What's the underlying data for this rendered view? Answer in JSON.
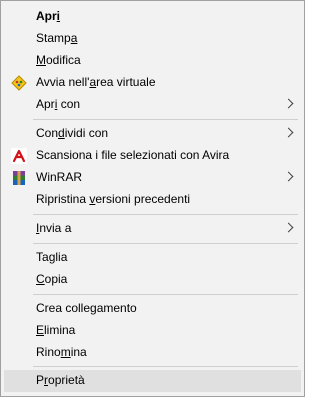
{
  "menu": {
    "items": [
      {
        "id": "apri",
        "pre": "Apr",
        "u": "i",
        "post": "",
        "bold": true
      },
      {
        "id": "stampa",
        "pre": "Stamp",
        "u": "a",
        "post": ""
      },
      {
        "id": "modifica",
        "pre": "",
        "u": "M",
        "post": "odifica"
      },
      {
        "id": "avvia",
        "pre": "Avvia nell'",
        "u": "a",
        "post": "rea virtuale"
      },
      {
        "id": "apri-con",
        "pre": "Apr",
        "u": "i",
        "post": " con"
      },
      {
        "id": "condividi",
        "pre": "Con",
        "u": "d",
        "post": "ividi con"
      },
      {
        "id": "avira",
        "text": "Scansiona i file selezionati con Avira"
      },
      {
        "id": "winrar",
        "text": "WinRAR"
      },
      {
        "id": "ripristina",
        "pre": "Ripristina ",
        "u": "v",
        "post": "ersioni precedenti"
      },
      {
        "id": "invia",
        "pre": "",
        "u": "I",
        "post": "nvia a"
      },
      {
        "id": "taglia",
        "pre": "Ta",
        "u": "g",
        "post": "lia"
      },
      {
        "id": "copia",
        "pre": "",
        "u": "C",
        "post": "opia"
      },
      {
        "id": "crea",
        "text": "Crea collegamento"
      },
      {
        "id": "elimina",
        "pre": "",
        "u": "E",
        "post": "limina"
      },
      {
        "id": "rinomina",
        "pre": "Rino",
        "u": "m",
        "post": "ina"
      },
      {
        "id": "proprieta",
        "pre": "P",
        "u": "r",
        "post": "oprietà"
      }
    ]
  },
  "icons": {
    "avvia": "virtual-area-icon",
    "avira": "avira-icon",
    "winrar": "winrar-icon"
  },
  "colors": {
    "menu_bg": "#f2f2f2",
    "hover_bg": "#e0e0e0",
    "separator": "#cfcfcf",
    "avira_red": "#d4111b"
  }
}
